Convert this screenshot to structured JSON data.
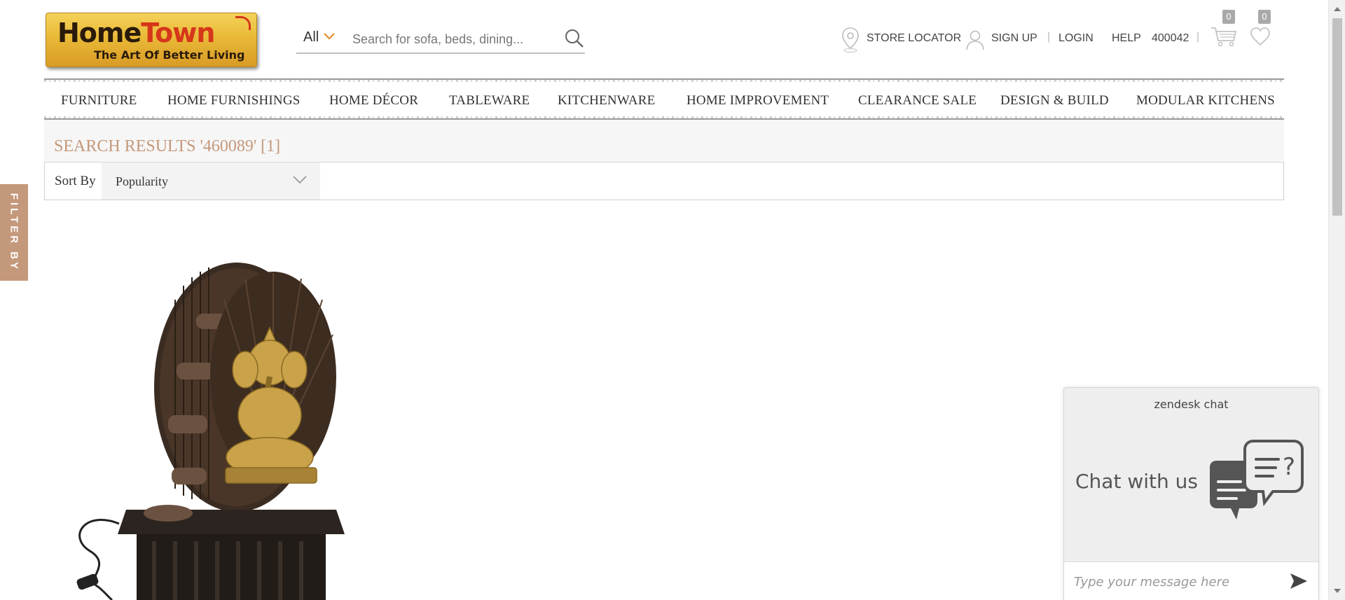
{
  "header": {
    "logo_main": "HomeTown",
    "logo_main_part1": "Home",
    "logo_main_part2": "T",
    "logo_main_part3": "wn",
    "logo_sub": "The Art Of Better Living",
    "search": {
      "category": "All",
      "placeholder": "Search for sofa, beds, dining..."
    },
    "utilities": {
      "store_locator": "STORE LOCATOR",
      "sign_up": "SIGN UP",
      "login": "LOGIN",
      "help": "HELP",
      "pincode": "400042",
      "separator": "|"
    },
    "cart_count": "0",
    "wishlist_count": "0"
  },
  "nav": {
    "items": [
      "FURNITURE",
      "HOME FURNISHINGS",
      "HOME DÉCOR",
      "TABLEWARE",
      "KITCHENWARE",
      "HOME IMPROVEMENT",
      "CLEARANCE SALE",
      "DESIGN & BUILD",
      "MODULAR KITCHENS"
    ]
  },
  "results": {
    "title": "SEARCH RESULTS '460089' [1]",
    "sort_label": "Sort By",
    "sort_value": "Popularity"
  },
  "filter_tab": {
    "label": "FILTER BY"
  },
  "product": {
    "image": "ganesha-tabletop-water-fountain"
  },
  "chat": {
    "brand": "zendesk chat",
    "title": "Chat with us",
    "input_placeholder": "Type your message here"
  },
  "colors": {
    "accent_tan": "#c4987a",
    "logo_gold": "#e9b937",
    "logo_red": "#d6361a",
    "chevron_orange": "#e98b2e"
  }
}
